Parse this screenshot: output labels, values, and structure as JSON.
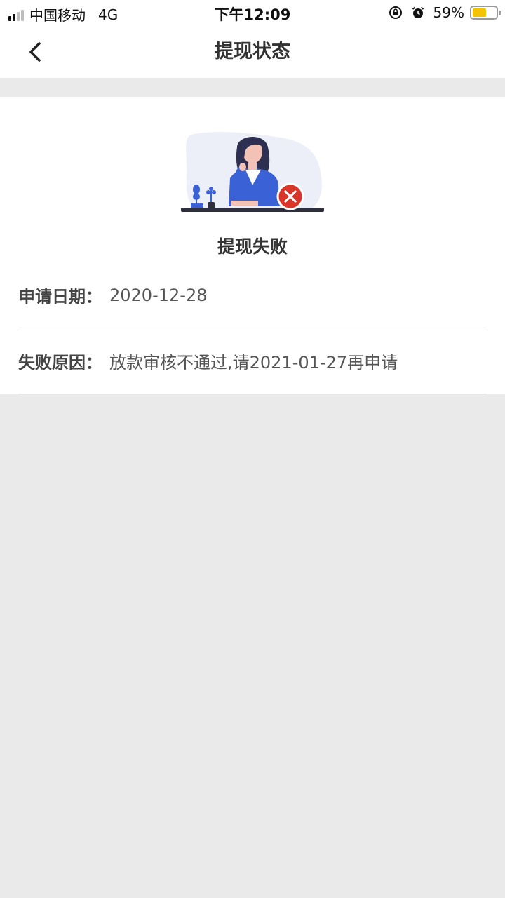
{
  "status_bar": {
    "carrier": "中国移动",
    "network": "4G",
    "time": "下午12:09",
    "battery": "59%",
    "battery_level": 0.59,
    "battery_color": "#f5c400"
  },
  "nav": {
    "title": "提现状态",
    "back_icon": "chevron-left-icon"
  },
  "result": {
    "illustration": "woman-at-desk-with-error-icon",
    "error_color": "#d9352a",
    "status_text": "提现失败"
  },
  "details": [
    {
      "label": "申请日期：",
      "value": "2020-12-28"
    },
    {
      "label": "失败原因：",
      "value": "放款审核不通过,请2021-01-27再申请"
    }
  ]
}
